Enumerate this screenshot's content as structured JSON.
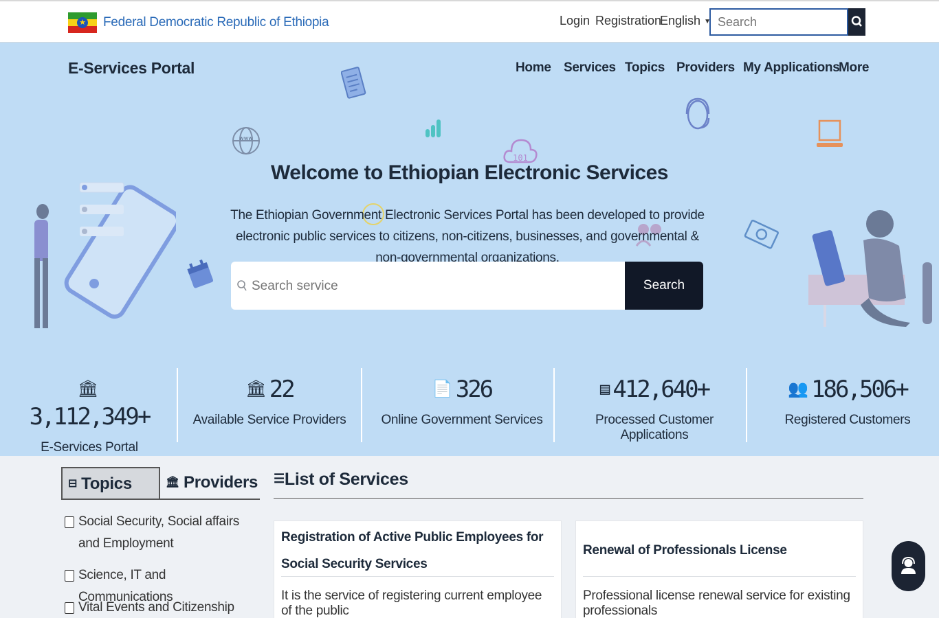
{
  "topbar": {
    "gov_name": "Federal Democratic Republic of Ethiopia",
    "login": "Login",
    "registration": "Registration",
    "language": "English",
    "search_placeholder": "Search"
  },
  "header": {
    "brand": "E-Services Portal",
    "nav": [
      "Home",
      "Services",
      "Topics",
      "Providers",
      "My Applications",
      "More"
    ]
  },
  "hero": {
    "title": "Welcome to Ethiopian Electronic Services",
    "description": "The Ethiopian Government Electronic Services Portal has been developed to provide electronic public services to citizens, non-citizens, businesses, and governmental & non-governmental organizations.",
    "search_placeholder": "Search service",
    "search_button": "Search"
  },
  "stats": [
    {
      "value": "3,112,349+",
      "label": "E-Services Portal Visitors",
      "icon": "bank-icon"
    },
    {
      "value": "22",
      "label": "Available Service Providers",
      "icon": "bank-icon"
    },
    {
      "value": "326",
      "label": "Online Government Services",
      "icon": "document-icon"
    },
    {
      "value": "412,640+",
      "label": "Processed Customer Applications",
      "icon": "form-icon"
    },
    {
      "value": "186,506+",
      "label": "Registered Customers",
      "icon": "users-icon"
    }
  ],
  "filters": {
    "tab_topics": "Topics",
    "tab_providers": "Providers",
    "topics": [
      "Social Security, Social affairs and Employment",
      "Science, IT and Communications",
      "Vital Events and Citizenship"
    ]
  },
  "services": {
    "heading": "List of Services",
    "cards": [
      {
        "title": "Registration of Active Public Employees for Social Security Services",
        "description": "It is the service of registering current employee of the public"
      },
      {
        "title": "Renewal of Professionals License",
        "description": "Professional license renewal service for existing professionals"
      }
    ]
  },
  "colors": {
    "hero_bg": "#bfdcf5",
    "accent_dark": "#111827",
    "link_blue": "#2b6bb8"
  }
}
